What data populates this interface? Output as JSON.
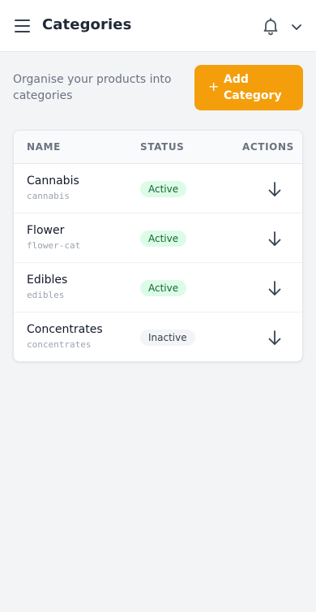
{
  "header": {
    "title": "Categories",
    "menu_icon": "hamburger-menu-icon",
    "notifications_icon": "bell-icon",
    "account_icon": "chevron-down-icon"
  },
  "intro": {
    "subtitle": "Organise your products into categories",
    "add_button_label": "Add Category",
    "add_button_icon": "+"
  },
  "table": {
    "columns": [
      "NAME",
      "STATUS",
      "ACTIONS"
    ],
    "rows": [
      {
        "name": "Cannabis",
        "slug": "cannabis",
        "status": "Active"
      },
      {
        "name": "Flower",
        "slug": "flower-cat",
        "status": "Active"
      },
      {
        "name": "Edibles",
        "slug": "edibles",
        "status": "Active"
      },
      {
        "name": "Concentrates",
        "slug": "concentrates",
        "status": "Inactive"
      }
    ],
    "row_action_icon": "arrow-down-icon"
  },
  "colors": {
    "accent": "#f59e0b",
    "active_badge_bg": "#dcfce7",
    "active_badge_text": "#166534",
    "inactive_badge_bg": "#f3f4f6",
    "background": "#f3f4f6"
  }
}
